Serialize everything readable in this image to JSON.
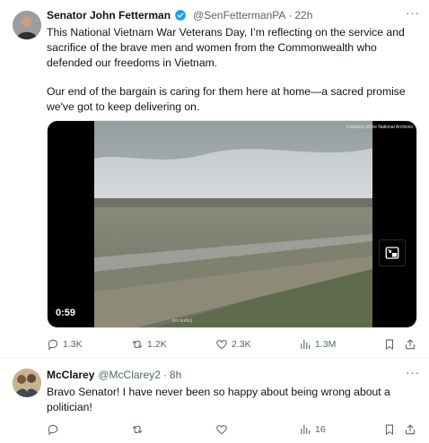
{
  "tweets": [
    {
      "author_name": "Senator John Fetterman",
      "handle": "@SenFettermanPA",
      "separator": "·",
      "time": "22h",
      "paragraph1": "This National Vietnam War Veterans Day, I’m reflecting on the service and sacrifice of the brave men and women from the Commonwealth who defended our freedoms in Vietnam.",
      "paragraph2": "Our end of the bargain is caring for them here at home—a sacred promise we've got to keep delivering on.",
      "video": {
        "duration": "0:59",
        "credit": "Courtesy of the National Archives",
        "caption": "[no audio]"
      },
      "actions": {
        "replies": "1.3K",
        "reposts": "1.2K",
        "likes": "2.3K",
        "views": "1.3M"
      }
    },
    {
      "author_name": "McClarey",
      "handle": "@McClarey2",
      "separator": "·",
      "time": "8h",
      "text": "Bravo Senator!  I have never been so happy about being wrong about a politician!",
      "actions": {
        "replies": "",
        "reposts": "",
        "likes": "",
        "views": "16"
      }
    }
  ],
  "icons": {
    "more": "more-dots-icon",
    "verified": "verified-badge-icon",
    "reply": "reply-icon",
    "repost": "repost-icon",
    "like": "heart-icon",
    "views": "views-icon",
    "bookmark": "bookmark-icon",
    "share": "share-icon",
    "minimize": "minimize-video-icon"
  },
  "colors": {
    "text_primary": "#0f1419",
    "text_secondary": "#536471",
    "verified_blue": "#1d9bf0",
    "divider": "#eff3f4"
  }
}
